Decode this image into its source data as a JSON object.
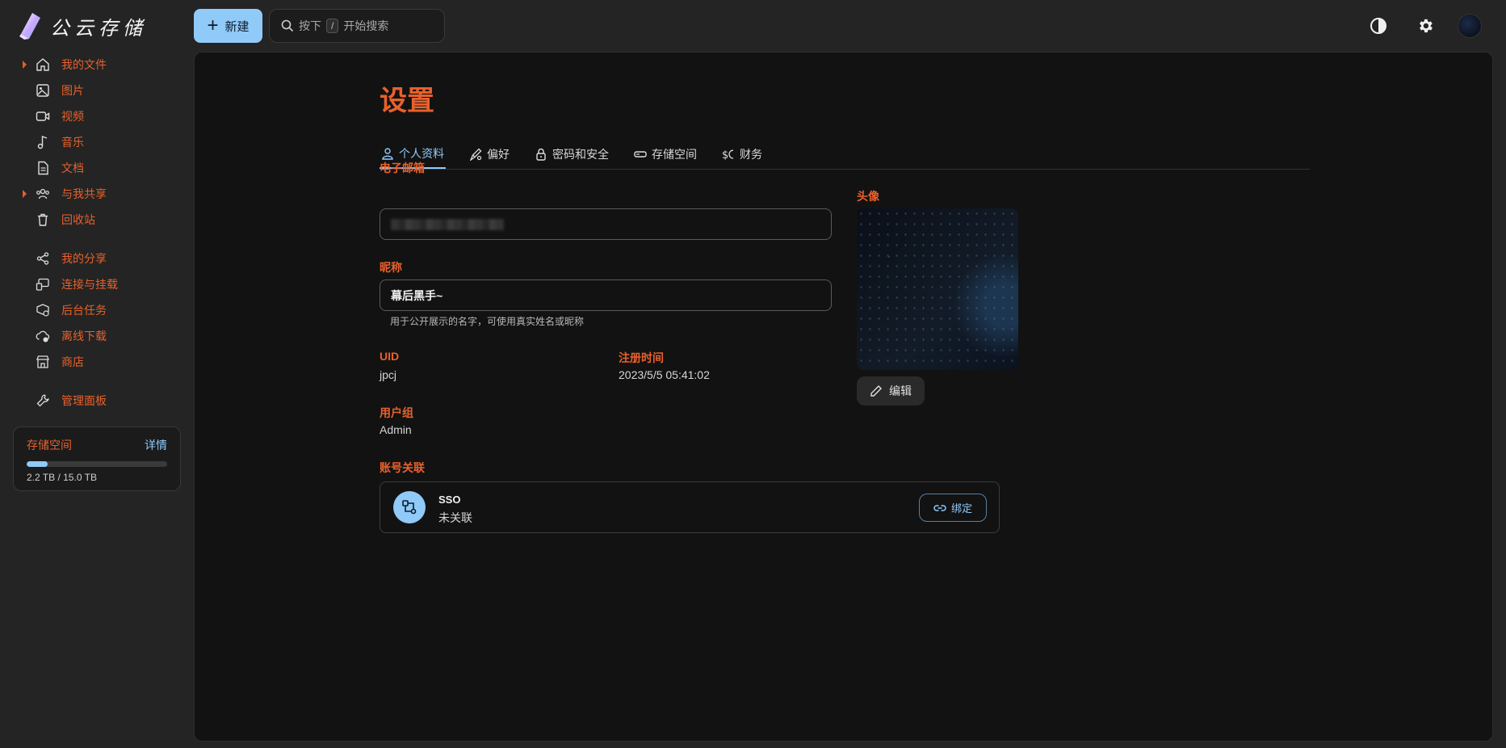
{
  "app": {
    "logo_text": "公云存储",
    "new_button": "新建",
    "search_prefix": "按下",
    "search_key": "/",
    "search_suffix": "开始搜索"
  },
  "sidebar": {
    "items": [
      {
        "label": "我的文件",
        "icon": "home-icon",
        "expandable": true
      },
      {
        "label": "图片",
        "icon": "image-icon",
        "expandable": false
      },
      {
        "label": "视频",
        "icon": "video-icon",
        "expandable": false
      },
      {
        "label": "音乐",
        "icon": "music-icon",
        "expandable": false
      },
      {
        "label": "文档",
        "icon": "document-icon",
        "expandable": false
      },
      {
        "label": "与我共享",
        "icon": "shared-people-icon",
        "expandable": true
      },
      {
        "label": "回收站",
        "icon": "trash-icon",
        "expandable": false
      },
      {
        "label": "我的分享",
        "icon": "share-icon",
        "expandable": false
      },
      {
        "label": "连接与挂载",
        "icon": "connect-icon",
        "expandable": false
      },
      {
        "label": "后台任务",
        "icon": "task-icon",
        "expandable": false
      },
      {
        "label": "离线下载",
        "icon": "cloud-download-icon",
        "expandable": false
      },
      {
        "label": "商店",
        "icon": "store-icon",
        "expandable": false
      },
      {
        "label": "管理面板",
        "icon": "wrench-icon",
        "expandable": false
      }
    ],
    "storage": {
      "title": "存储空间",
      "detail": "详情",
      "usage": "2.2 TB / 15.0 TB",
      "fraction": 0.147
    }
  },
  "settings": {
    "title": "设置",
    "tabs": [
      {
        "label": "个人资料",
        "icon": "person-icon",
        "active": true
      },
      {
        "label": "偏好",
        "icon": "brush-settings-icon",
        "active": false
      },
      {
        "label": "密码和安全",
        "icon": "lock-icon",
        "active": false
      },
      {
        "label": "存储空间",
        "icon": "storage-icon",
        "active": false
      },
      {
        "label": "财务",
        "icon": "currency-icon",
        "active": false
      }
    ],
    "email_label": "电子邮箱",
    "nickname_label": "昵称",
    "nickname_value": "幕后黑手~",
    "nickname_helper": "用于公开展示的名字，可使用真实姓名或昵称",
    "uid_label": "UID",
    "uid_value": "jpcj",
    "reg_label": "注册时间",
    "reg_value": "2023/5/5 05:41:02",
    "group_label": "用户组",
    "group_value": "Admin",
    "avatar_label": "头像",
    "edit_button": "编辑",
    "account_label": "账号关联",
    "sso_title": "SSO",
    "sso_status": "未关联",
    "bind_button": "绑定"
  },
  "colors": {
    "accent": "#e8612c",
    "primary": "#90caf9",
    "background": "#242424",
    "panel": "#121212"
  }
}
